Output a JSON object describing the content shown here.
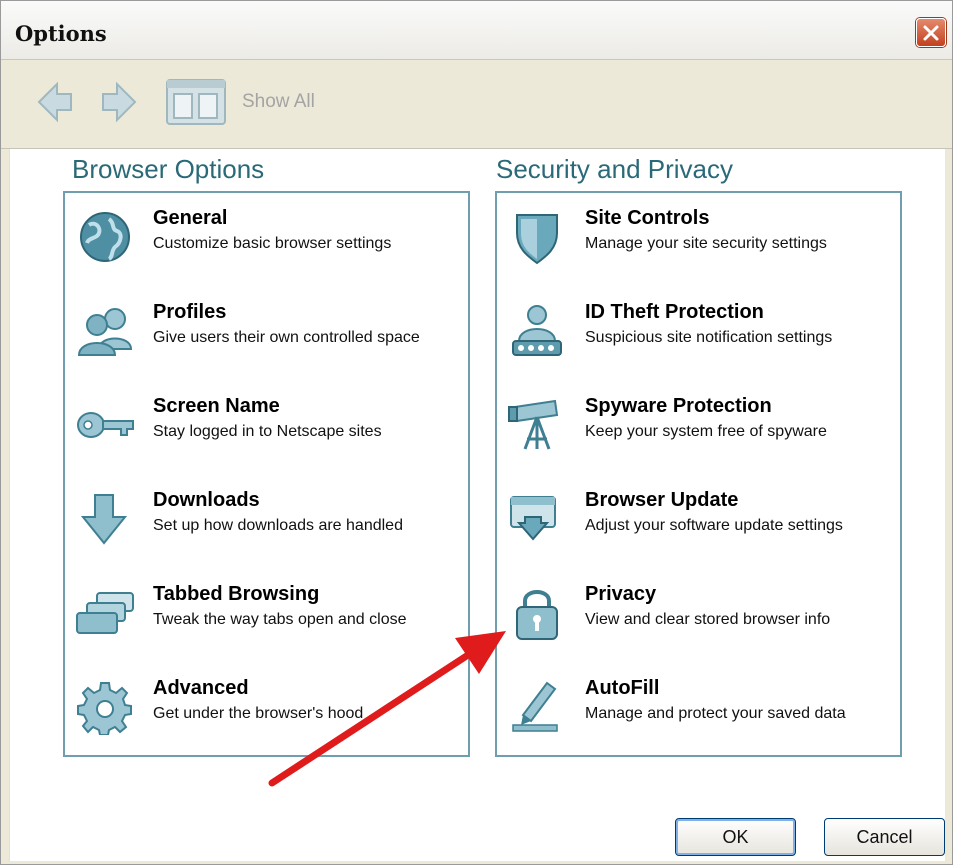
{
  "window": {
    "title": "Options"
  },
  "toolbar": {
    "show_all_label": "Show All"
  },
  "browser_options": {
    "heading": "Browser Options",
    "items": [
      {
        "label": "General",
        "desc": "Customize basic browser settings",
        "icon": "globe-icon"
      },
      {
        "label": "Profiles",
        "desc": "Give users their own controlled space",
        "icon": "users-icon"
      },
      {
        "label": "Screen Name",
        "desc": "Stay logged in to Netscape sites",
        "icon": "key-icon"
      },
      {
        "label": "Downloads",
        "desc": "Set up how downloads are handled",
        "icon": "download-arrow-icon"
      },
      {
        "label": "Tabbed Browsing",
        "desc": "Tweak the way tabs open and close",
        "icon": "tabs-icon"
      },
      {
        "label": "Advanced",
        "desc": "Get under the browser's hood",
        "icon": "gear-icon"
      }
    ]
  },
  "security_privacy": {
    "heading": "Security and Privacy",
    "items": [
      {
        "label": "Site Controls",
        "desc": "Manage your site security settings",
        "icon": "shield-icon"
      },
      {
        "label": "ID Theft Protection",
        "desc": "Suspicious site notification settings",
        "icon": "fingerprint-person-icon"
      },
      {
        "label": "Spyware Protection",
        "desc": "Keep your system free of spyware",
        "icon": "telescope-icon"
      },
      {
        "label": "Browser Update",
        "desc": "Adjust your software update settings",
        "icon": "update-icon"
      },
      {
        "label": "Privacy",
        "desc": "View and clear stored browser info",
        "icon": "padlock-icon"
      },
      {
        "label": "AutoFill",
        "desc": "Manage and protect your saved data",
        "icon": "pen-icon"
      }
    ]
  },
  "buttons": {
    "ok": "OK",
    "cancel": "Cancel"
  },
  "colors": {
    "accent": "#2a6a78",
    "icon": "#5fa0b3",
    "annotation_arrow": "#e01b1b"
  }
}
